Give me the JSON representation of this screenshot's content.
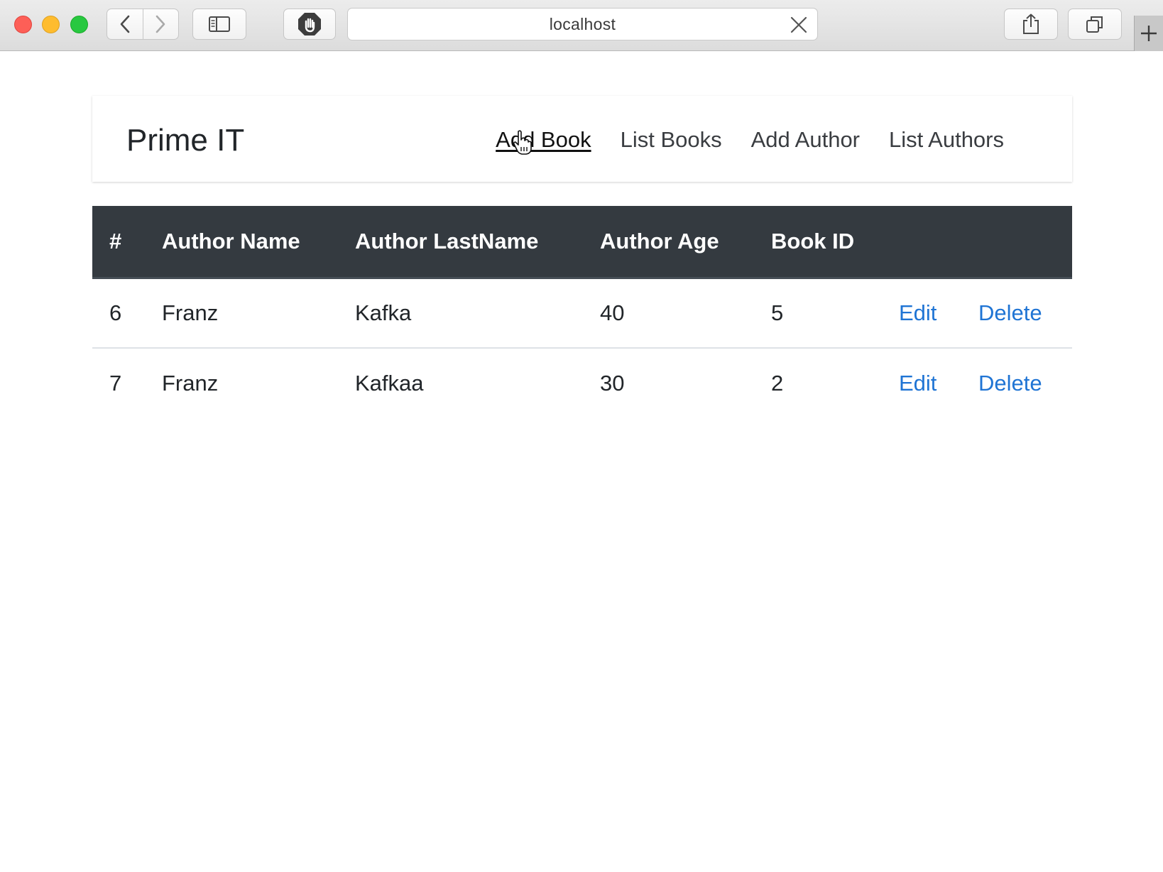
{
  "browser": {
    "url": "localhost"
  },
  "navbar": {
    "brand": "Prime IT",
    "links": [
      "Add Book",
      "List Books",
      "Add Author",
      "List Authors"
    ]
  },
  "table": {
    "headers": [
      "#",
      "Author Name",
      "Author LastName",
      "Author Age",
      "Book ID"
    ],
    "rows": [
      {
        "id": "6",
        "name": "Franz",
        "lastname": "Kafka",
        "age": "40",
        "book_id": "5",
        "edit": "Edit",
        "delete": "Delete"
      },
      {
        "id": "7",
        "name": "Franz",
        "lastname": "Kafkaa",
        "age": "30",
        "book_id": "2",
        "edit": "Edit",
        "delete": "Delete"
      }
    ]
  },
  "colors": {
    "header_bg": "#343a40",
    "link": "#1f74d4"
  }
}
